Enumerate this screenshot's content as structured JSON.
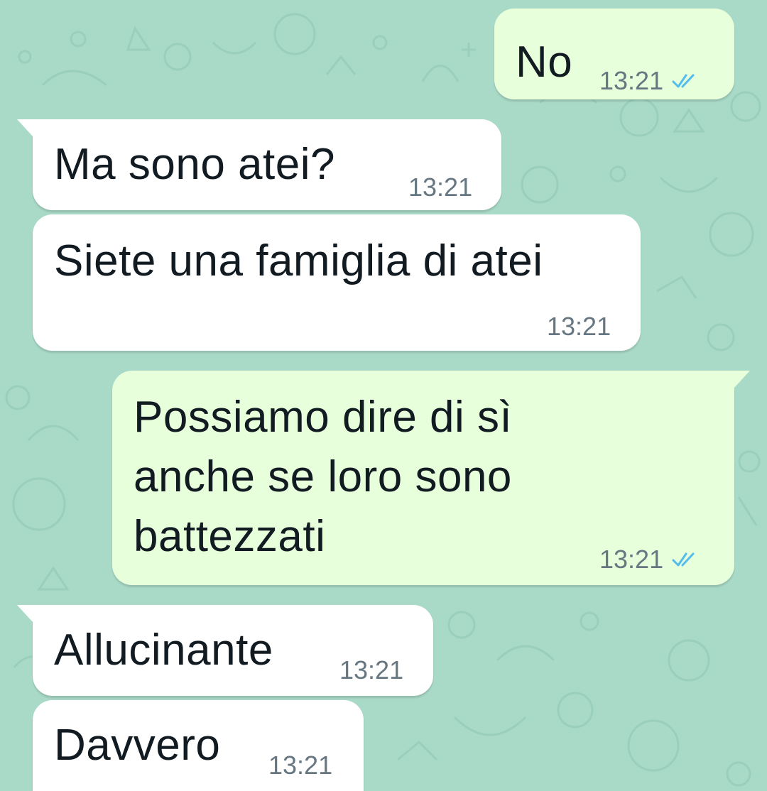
{
  "chat": {
    "background_color": "#a9d9c7",
    "incoming_color": "#ffffff",
    "outgoing_color": "#e7ffdb",
    "read_tick_color": "#53bdeb",
    "messages": [
      {
        "direction": "outgoing",
        "text": "No",
        "time": "13:21",
        "status": "read"
      },
      {
        "direction": "incoming",
        "text": "Ma sono atei?",
        "time": "13:21"
      },
      {
        "direction": "incoming",
        "text": "Siete una famiglia di atei",
        "time": "13:21"
      },
      {
        "direction": "outgoing",
        "text_lines": [
          "Possiamo dire di sì",
          "anche se loro sono",
          "battezzati"
        ],
        "time": "13:21",
        "status": "read"
      },
      {
        "direction": "incoming",
        "text": "Allucinante",
        "time": "13:21"
      },
      {
        "direction": "incoming",
        "text": "Davvero",
        "time": "13:21"
      }
    ]
  }
}
